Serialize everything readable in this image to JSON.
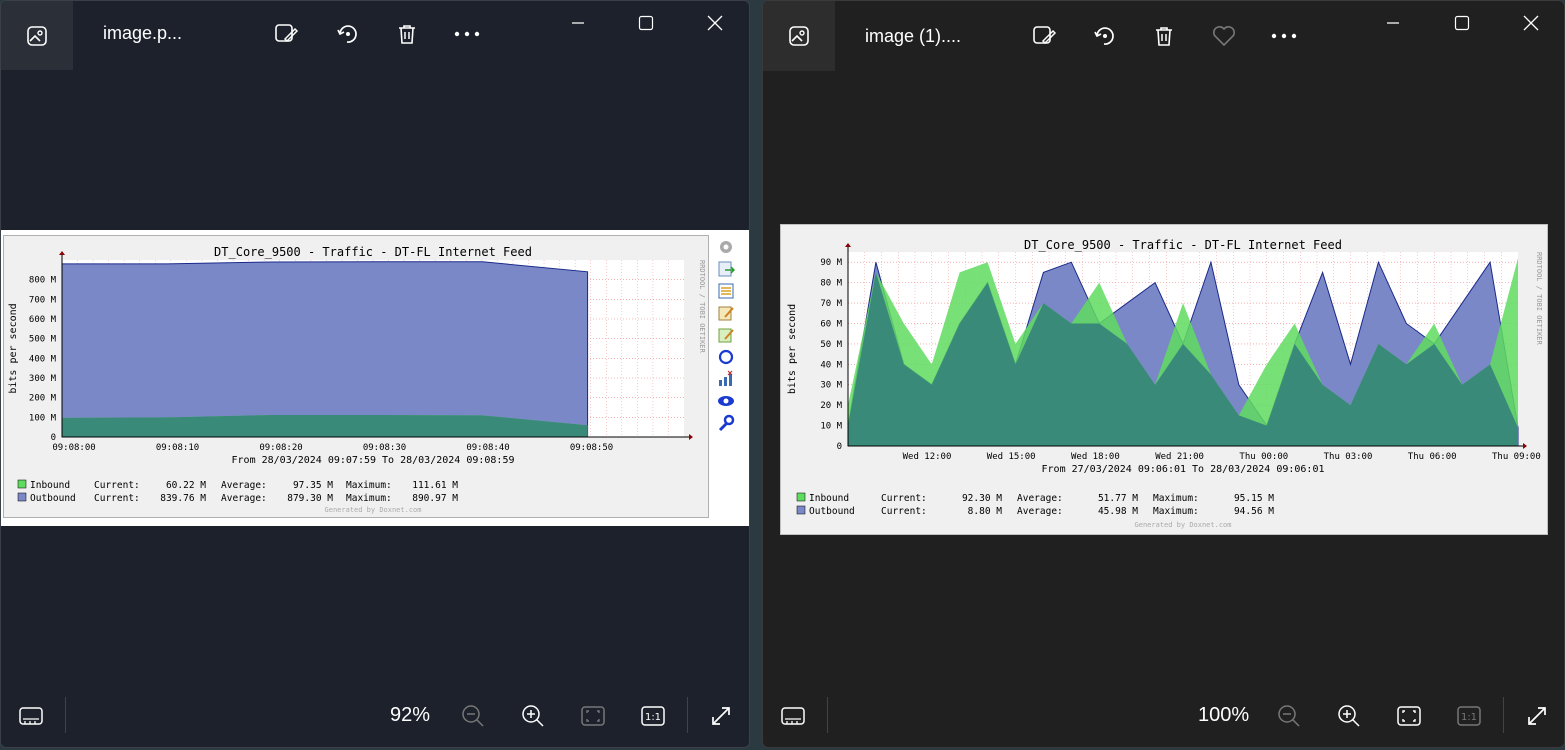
{
  "left_window": {
    "filename": "image.p...",
    "zoom": "92%",
    "graph": {
      "title": "DT_Core_9500 - Traffic - DT-FL Internet Feed",
      "ylabel": "bits per second",
      "side_label": "RRDTOOL / TOBI OETIKER",
      "time_range": "From 28/03/2024 09:07:59 To 28/03/2024 09:08:59",
      "footer": "Generated by Doxnet.com",
      "legend": [
        {
          "name": "Inbound",
          "current": "60.22 M",
          "average": "97.35 M",
          "maximum": "111.61 M"
        },
        {
          "name": "Outbound",
          "current": "839.76 M",
          "average": "879.30 M",
          "maximum": "890.97 M"
        }
      ],
      "legend_labels": {
        "current": "Current:",
        "average": "Average:",
        "maximum": "Maximum:"
      },
      "side_icons": [
        "gear-icon",
        "export-icon",
        "list-icon",
        "edit-icon",
        "edit2-icon",
        "refresh-icon",
        "chart-icon",
        "eye-icon",
        "wrench-icon"
      ]
    }
  },
  "right_window": {
    "filename": "image (1)....",
    "zoom": "100%",
    "graph": {
      "title": "DT_Core_9500 - Traffic - DT-FL Internet Feed",
      "ylabel": "bits per second",
      "side_label": "RRDTOOL / TOBI OETIKER",
      "time_range": "From 27/03/2024 09:06:01 To 28/03/2024 09:06:01",
      "footer": "Generated by Doxnet.com",
      "legend": [
        {
          "name": "Inbound",
          "current": "92.30 M",
          "average": "51.77 M",
          "maximum": "95.15 M"
        },
        {
          "name": "Outbound",
          "current": "8.80 M",
          "average": "45.98 M",
          "maximum": "94.56 M"
        }
      ],
      "legend_labels": {
        "current": "Current:",
        "average": "Average:",
        "maximum": "Maximum:"
      }
    }
  },
  "colors": {
    "inbound_fill": "#5fdc5f",
    "outbound_fill": "#7b88c8",
    "overlap": "#3a8a7a",
    "grid": "#f08080"
  },
  "chart_data": [
    {
      "type": "area",
      "title": "DT_Core_9500 - Traffic - DT-FL Internet Feed",
      "ylabel": "bits per second",
      "x": [
        "09:08:00",
        "09:08:10",
        "09:08:20",
        "09:08:30",
        "09:08:40",
        "09:08:50"
      ],
      "yticks": [
        "0",
        "100 M",
        "200 M",
        "300 M",
        "400 M",
        "500 M",
        "600 M",
        "700 M",
        "800 M"
      ],
      "ylim": [
        0,
        900
      ],
      "series": [
        {
          "name": "Inbound",
          "values": [
            97,
            100,
            112,
            112,
            110,
            60
          ]
        },
        {
          "name": "Outbound",
          "values": [
            880,
            880,
            890,
            891,
            891,
            840
          ]
        }
      ]
    },
    {
      "type": "area",
      "title": "DT_Core_9500 - Traffic - DT-FL Internet Feed",
      "ylabel": "bits per second",
      "x": [
        "Wed 12:00",
        "Wed 15:00",
        "Wed 18:00",
        "Wed 21:00",
        "Thu 00:00",
        "Thu 03:00",
        "Thu 06:00",
        "Thu 09:00"
      ],
      "yticks": [
        "0",
        "10 M",
        "20 M",
        "30 M",
        "40 M",
        "50 M",
        "60 M",
        "70 M",
        "80 M",
        "90 M"
      ],
      "ylim": [
        0,
        95
      ],
      "series": [
        {
          "name": "Inbound",
          "values": [
            20,
            85,
            60,
            40,
            85,
            90,
            50,
            70,
            60,
            80,
            50,
            30,
            70,
            35,
            15,
            40,
            60,
            30,
            20,
            50,
            40,
            60,
            30,
            40,
            92
          ]
        },
        {
          "name": "Outbound",
          "values": [
            10,
            90,
            40,
            30,
            60,
            80,
            40,
            85,
            90,
            60,
            70,
            80,
            50,
            90,
            30,
            10,
            50,
            85,
            40,
            90,
            60,
            50,
            70,
            90,
            9
          ]
        }
      ]
    }
  ]
}
